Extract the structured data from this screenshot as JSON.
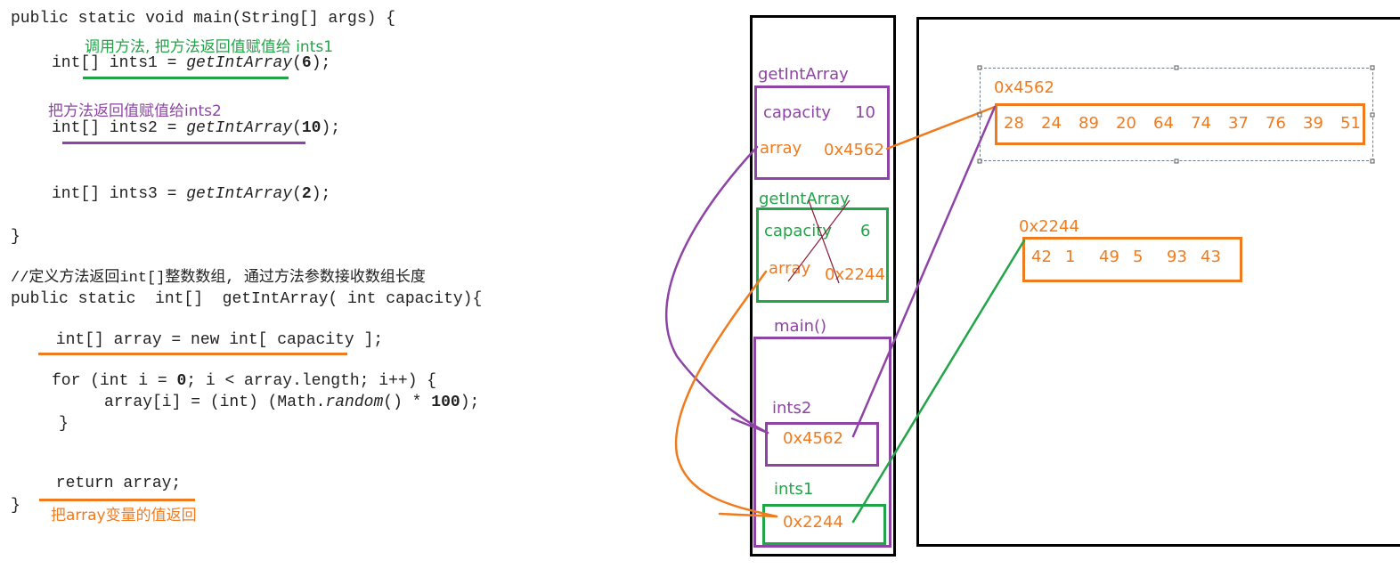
{
  "colors": {
    "green": "#21a548",
    "purple": "#8e44a5",
    "orange": "#f07b1e",
    "black": "#000000"
  },
  "code": {
    "main_sig": "public static void main(String[] args) {",
    "note_ints1": "调用方法, 把方法返回值赋值给 ints1",
    "ints1_prefix": "int[] ints1 = ",
    "ints1_call": "getIntArray",
    "ints1_arg": "6",
    "note_ints2": "把方法返回值赋值给ints2",
    "ints2_prefix": "int[] ints2 = ",
    "ints2_call": "getIntArray",
    "ints2_arg": "10",
    "ints3_prefix": "int[] ints3 = ",
    "ints3_call": "getIntArray",
    "ints3_arg": "2",
    "close_main": "}",
    "comment": "//定义方法返回int[]整数数组, 通过方法参数接收数组长度",
    "method_sig": "public static  int[]  getIntArray( int capacity){",
    "array_decl": " int[] array = new int[ capacity ];",
    "for_line_a": "for (int i = ",
    "for_zero": "0",
    "for_line_b": "; i < array.length; i++) {",
    "assign_a": "array[i] = (int) (Math.",
    "assign_random": "random",
    "assign_b": "() * ",
    "assign_100": "100",
    "assign_c": ");",
    "close_for": "}",
    "return_line": " return array;",
    "close_method": "}",
    "note_return": "把array变量的值返回"
  },
  "stack": {
    "frame_top": {
      "title": "getIntArray",
      "capacity_label": "capacity",
      "capacity_value": "10",
      "array_label": "array",
      "array_value": "0x4562"
    },
    "frame_mid": {
      "title": "getIntArray",
      "capacity_label": "capacity",
      "capacity_value": "6",
      "array_label": "array",
      "array_value": "0x2244"
    },
    "frame_main": {
      "title": "main()",
      "ints2_label": "ints2",
      "ints2_value": "0x4562",
      "ints1_label": "ints1",
      "ints1_value": "0x2244"
    }
  },
  "heap": {
    "array1": {
      "address": "0x4562",
      "values": [
        "28",
        "24",
        "89",
        "20",
        "64",
        "74",
        "37",
        "76",
        "39",
        "51"
      ]
    },
    "array2": {
      "address": "0x2244",
      "values": [
        "42",
        "1",
        "49",
        "5",
        "93",
        "43"
      ]
    }
  }
}
